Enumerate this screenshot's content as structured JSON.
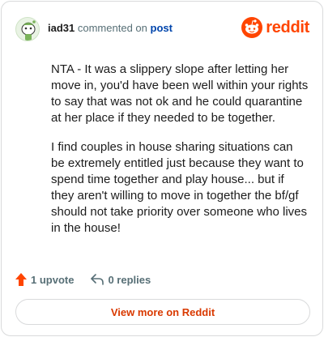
{
  "header": {
    "username": "iad31",
    "commented_text": "commented on",
    "post_link": "post",
    "brand": "reddit",
    "brand_color": "#ff4500",
    "avatar_icon": "snoo-avatar-icon",
    "logo_icon": "reddit-logo-icon"
  },
  "comment": {
    "paragraphs": [
      "NTA - It was a slippery slope after letting her move in, you'd have been well within your rights to say that was not ok and he could quarantine at her place if they needed to be together.",
      "I find couples in house sharing situations can be extremely entitled just because they want to spend time together and play house... but if they aren't willing to move in together the bf/gf should not take priority over someone who lives in the house!"
    ]
  },
  "footer": {
    "upvotes": "1 upvote",
    "replies": "0 replies",
    "upvote_icon": "upvote-arrow-icon",
    "reply_icon": "reply-icon",
    "upvote_color": "#ff4500"
  },
  "cta": {
    "label": "View more on Reddit",
    "color": "#d93900"
  }
}
